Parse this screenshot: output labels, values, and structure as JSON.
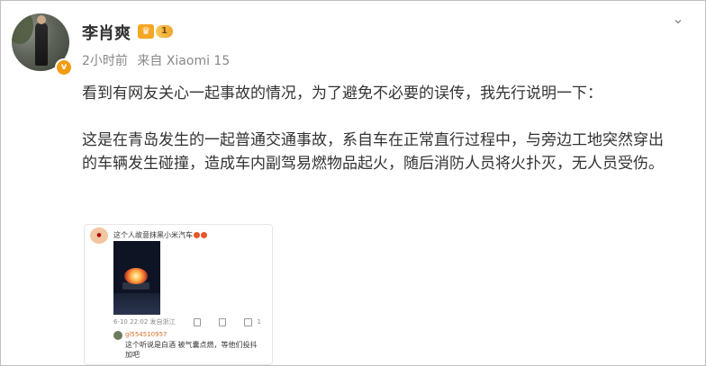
{
  "post": {
    "username": "李肖爽",
    "level": "1",
    "time": "2小时前",
    "source": "来自 Xiaomi 15",
    "paragraphs": [
      "看到有网友关心一起事故的情况，为了避免不必要的误传，我先行说明一下：",
      "这是在青岛发生的一起普通交通事故，系自车在正常直行过程中，与旁边工地突然穿出的车辆发生碰撞，造成车内副驾易燃物品起火，随后消防人员将火扑灭，无人员受伤。"
    ]
  },
  "embed": {
    "title": "这个人故意抹黑小米汽车",
    "date_location": "6-10 22:02 发自浙江",
    "comment_user": "gl554510957",
    "comment_text": "这个听说是白酒 被气囊点燃，等他们投抖加吧",
    "like_count": "1"
  },
  "icons": {
    "dropdown": "chevron-down-icon",
    "verify": "verified-badge-icon",
    "level": "crown-level-icon"
  },
  "colors": {
    "verify_badge": "#f39c12",
    "level_gold": "#f5a623",
    "meta_text": "#888888"
  }
}
